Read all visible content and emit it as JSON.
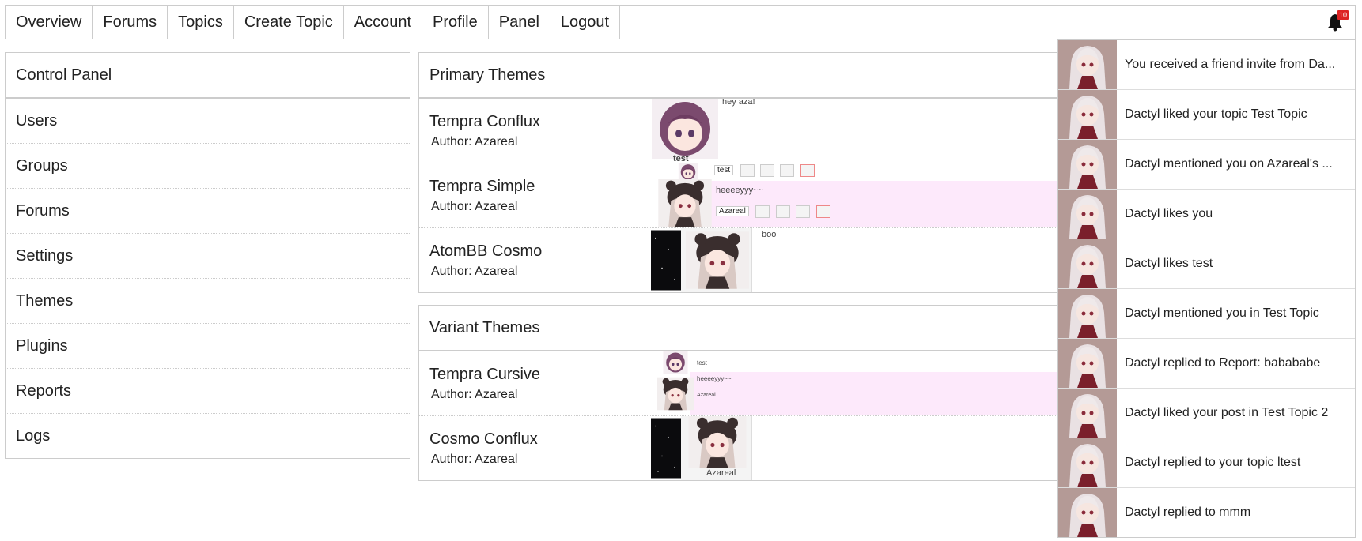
{
  "nav": {
    "items": [
      "Overview",
      "Forums",
      "Topics",
      "Create Topic",
      "Account",
      "Profile",
      "Panel",
      "Logout"
    ],
    "alert_count": "10"
  },
  "sidebar": {
    "title": "Control Panel",
    "items": [
      "Users",
      "Groups",
      "Forums",
      "Settings",
      "Themes",
      "Plugins",
      "Reports",
      "Logs"
    ]
  },
  "primary": {
    "title": "Primary Themes",
    "themes": [
      {
        "name": "Tempra Conflux",
        "author": "Author: Azareal",
        "preview": [
          "hey aza!",
          "test"
        ]
      },
      {
        "name": "Tempra Simple",
        "author": "Author: Azareal",
        "preview": [
          "test",
          "heeeeyyy~~",
          "Azareal"
        ]
      },
      {
        "name": "AtomBB Cosmo",
        "author": "Author: Azareal",
        "preview": [
          "boo"
        ]
      }
    ]
  },
  "variant": {
    "title": "Variant Themes",
    "themes": [
      {
        "name": "Tempra Cursive",
        "author": "Author: Azareal",
        "preview": [
          "test",
          "heeeeyyy~~",
          "Azareal"
        ]
      },
      {
        "name": "Cosmo Conflux",
        "author": "Author: Azareal",
        "preview": [
          "Azareal"
        ]
      }
    ]
  },
  "alerts": [
    "You received a friend invite from Da...",
    "Dactyl liked your topic Test Topic",
    "Dactyl mentioned you on Azareal's ...",
    "Dactyl likes you",
    "Dactyl likes test",
    "Dactyl mentioned you in Test Topic",
    "Dactyl replied to Report: babababe",
    "Dactyl liked your post in Test Topic 2",
    "Dactyl replied to your topic ltest",
    "Dactyl replied to mmm"
  ],
  "colors": {
    "alert_badge": "#dd2222",
    "pink_post": "#fde9fb"
  }
}
